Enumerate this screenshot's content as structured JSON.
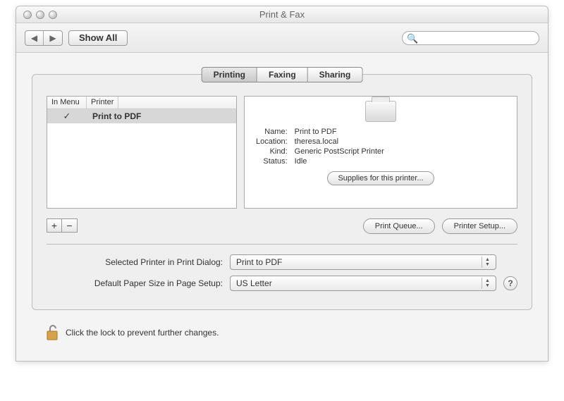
{
  "window_title": "Print & Fax",
  "toolbar": {
    "show_all": "Show All",
    "search_placeholder": ""
  },
  "tabs": {
    "printing": "Printing",
    "faxing": "Faxing",
    "sharing": "Sharing"
  },
  "list": {
    "col_in_menu": "In Menu",
    "col_printer": "Printer",
    "rows": [
      {
        "in_menu": "✓",
        "name": "Print to PDF"
      }
    ]
  },
  "detail": {
    "name_label": "Name:",
    "name_value": "Print to PDF",
    "location_label": "Location:",
    "location_value": "theresa.local",
    "kind_label": "Kind:",
    "kind_value": "Generic PostScript Printer",
    "status_label": "Status:",
    "status_value": "Idle",
    "supplies_btn": "Supplies for this printer..."
  },
  "buttons": {
    "add": "+",
    "remove": "−",
    "print_queue": "Print Queue...",
    "printer_setup": "Printer Setup..."
  },
  "form": {
    "selected_printer_label": "Selected Printer in Print Dialog:",
    "selected_printer_value": "Print to PDF",
    "paper_size_label": "Default Paper Size in Page Setup:",
    "paper_size_value": "US Letter"
  },
  "lock_text": "Click the lock to prevent further changes."
}
